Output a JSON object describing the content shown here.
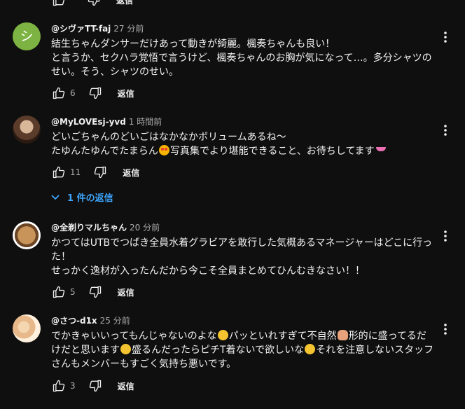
{
  "reply_label": "返信",
  "top_partial": {
    "reply_label": "返信"
  },
  "comments": [
    {
      "author": "@シヴァTT-faj",
      "time": "27 分前",
      "avatar_letter": "シ",
      "avatar_color": "#7cb342",
      "lines": [
        "結生ちゃんダンサーだけあって動きが綺麗。楓奏ちゃんも良い！",
        "と言うか、セクハラ覚悟で言うけど、楓奏ちゃんのお胸が気になって…。多分シャツのせい。そう、シャツのせい。"
      ],
      "likes": "6"
    },
    {
      "author": "@MyLOVEsj-yvd",
      "time": "1 時間前",
      "line1": "どいごちゃんのどいごはなかなかボリュームあるね～",
      "line2a": "たゆんたゆんでたまらん",
      "line2b": "写真集でより堪能できること、お待ちしてます",
      "emoji_a": "heart-eyes-emoji",
      "emoji_b": "bikini-emoji",
      "likes": "11",
      "replies_label": "1 件の返信"
    },
    {
      "author": "@全剃りマルちゃん",
      "time": "20 分前",
      "lines": [
        "かつてはUTBでつばき全員水着グラビアを敢行した気概あるマネージャーはどこに行った！",
        "せっかく逸材が入ったんだから今こそ全員まとめてひんむきなさい！！"
      ],
      "likes": "5"
    },
    {
      "author": "@さつ-d1x",
      "time": "25 分前",
      "seg1": "でかきゃいいってもんじゃないのよな",
      "seg2": "パッといれすぎて不自然",
      "seg3": "形的に盛ってるだけだと思います",
      "seg4": "盛るんだったらピチT着ないで欲しいな",
      "seg5": "それを注意しないスタッフさんもメンバーもすごく気持ち悪いです。",
      "emoji_1": "grinning-sweat-emoji",
      "emoji_2": "person-gesturing-no-emoji",
      "emoji_3": "sad-face-emoji",
      "emoji_4": "grinning-sweat-emoji",
      "likes": "3"
    }
  ],
  "colors": {
    "background": "#0f0f0f",
    "text": "#f1f1f1",
    "secondary_text": "#aaaaaa",
    "link_blue": "#3ea6ff"
  }
}
